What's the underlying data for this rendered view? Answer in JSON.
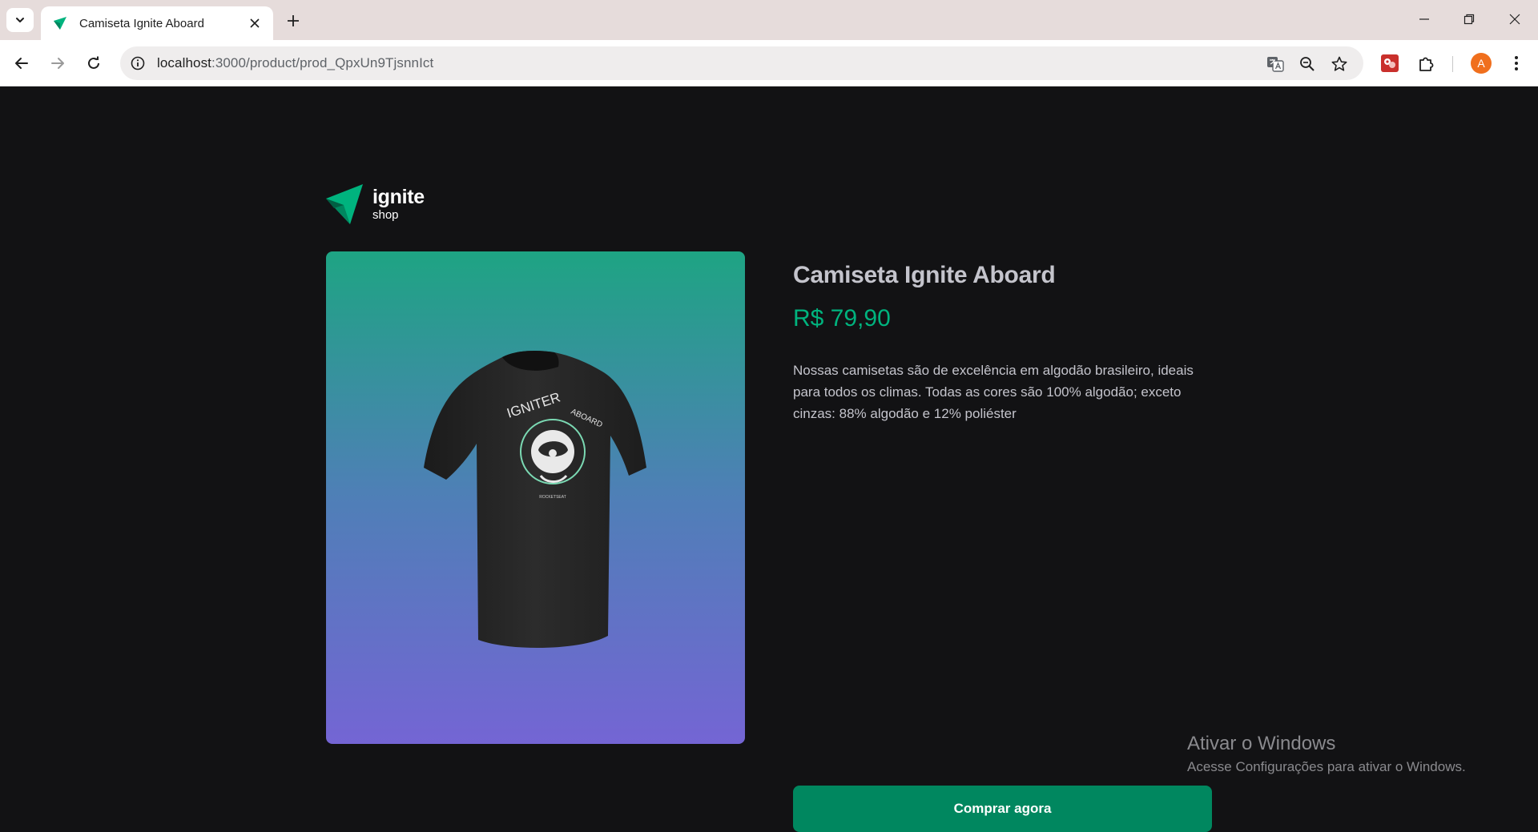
{
  "browser": {
    "tab": {
      "title": "Camiseta Ignite Aboard"
    },
    "address": {
      "host": "localhost",
      "path": ":3000/product/prod_QpxUn9TjsnnIct"
    },
    "profile_initial": "A",
    "icons": [
      "tab-search-icon",
      "close-icon",
      "plus-icon",
      "minimize-icon",
      "restore-icon",
      "window-close-icon",
      "back-arrow-icon",
      "forward-arrow-icon",
      "reload-icon",
      "site-info-icon",
      "translate-icon",
      "zoom-out-icon",
      "star-icon",
      "extension-icon",
      "puzzle-icon",
      "kebab-menu-icon"
    ]
  },
  "brand": {
    "name": "ignite",
    "sub": "shop"
  },
  "product": {
    "title": "Camiseta Ignite Aboard",
    "price": "R$ 79,90",
    "description": "Nossas camisetas são de excelência em algodão brasileiro, ideais para todos os climas. Todas as cores são 100% algodão; exceto cinzas: 88% algodão e 12% poliéster",
    "buy_label": "Comprar agora",
    "shirt_print": {
      "top_text": "IGNITER",
      "side_text": "ABOARD",
      "brand_mark": "ROCKETSEAT"
    }
  },
  "watermark": {
    "title": "Ativar o Windows",
    "subtitle": "Acesse Configurações para ativar o Windows."
  },
  "colors": {
    "page_bg": "#121214",
    "accent_green": "#00875f",
    "price_green": "#00b37e",
    "text_gray": "#c4c4cc",
    "gradient_top": "#1ea483",
    "gradient_bottom": "#7465d4"
  }
}
